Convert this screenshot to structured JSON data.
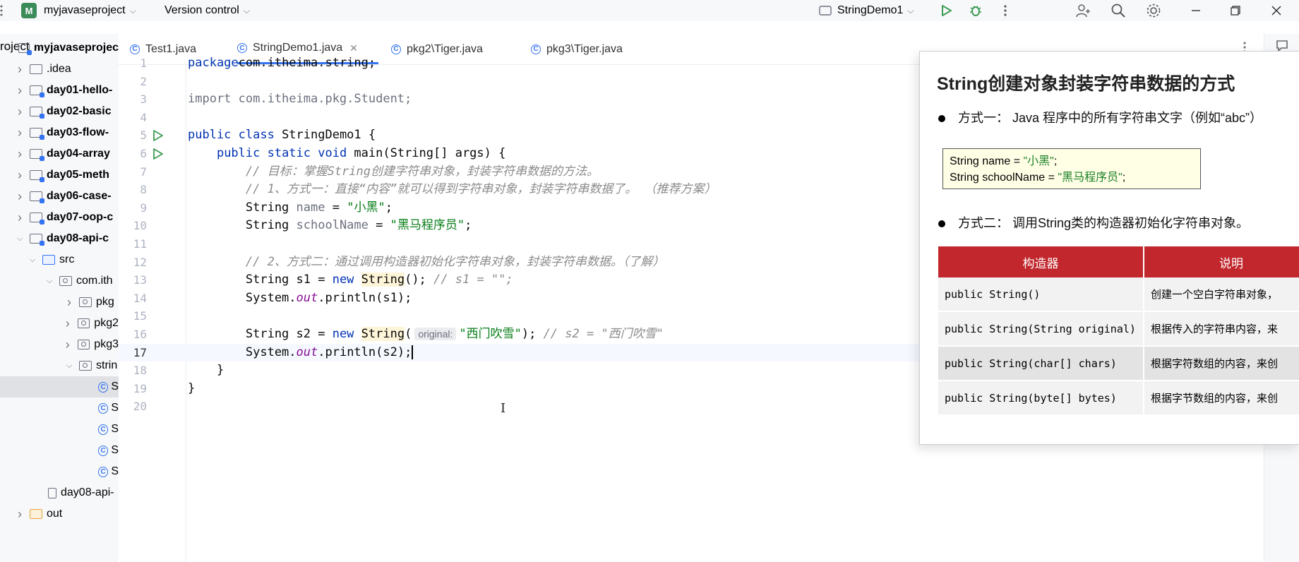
{
  "titlebar": {
    "project_badge": "M",
    "project_name": "myjavaseproject",
    "vcs": "Version control",
    "run_config": "StringDemo1",
    "icons": [
      "run-icon",
      "debug-icon",
      "more-icon",
      "add-user-icon",
      "search-icon",
      "settings-icon",
      "minimize-icon",
      "restore-icon",
      "close-icon"
    ]
  },
  "sidebar": {
    "header": "roject",
    "items": [
      {
        "label": "myjavaseprojec",
        "kind": "module",
        "arrow": "down"
      },
      {
        "label": ".idea",
        "kind": "folder",
        "arrow": "right"
      },
      {
        "label": "day01-hello-",
        "kind": "module",
        "arrow": "right"
      },
      {
        "label": "day02-basic",
        "kind": "module",
        "arrow": "right"
      },
      {
        "label": "day03-flow-",
        "kind": "module",
        "arrow": "right"
      },
      {
        "label": "day04-array",
        "kind": "module",
        "arrow": "right"
      },
      {
        "label": "day05-meth",
        "kind": "module",
        "arrow": "right"
      },
      {
        "label": "day06-case-",
        "kind": "module",
        "arrow": "right"
      },
      {
        "label": "day07-oop-c",
        "kind": "module",
        "arrow": "right"
      },
      {
        "label": "day08-api-c",
        "kind": "module",
        "arrow": "down"
      },
      {
        "label": "src",
        "kind": "src",
        "arrow": "down"
      },
      {
        "label": "com.ith",
        "kind": "package",
        "arrow": "down"
      },
      {
        "label": "pkg",
        "kind": "package",
        "arrow": "right"
      },
      {
        "label": "pkg2",
        "kind": "package",
        "arrow": "right"
      },
      {
        "label": "pkg3",
        "kind": "package",
        "arrow": "right"
      },
      {
        "label": "strin",
        "kind": "package",
        "arrow": "down"
      },
      {
        "label": "S",
        "kind": "class",
        "arrow": ""
      },
      {
        "label": "S",
        "kind": "class",
        "arrow": ""
      },
      {
        "label": "S",
        "kind": "class",
        "arrow": ""
      },
      {
        "label": "S",
        "kind": "class",
        "arrow": ""
      },
      {
        "label": "S",
        "kind": "class",
        "arrow": ""
      },
      {
        "label": "day08-api-",
        "kind": "file",
        "arrow": ""
      },
      {
        "label": "out",
        "kind": "out",
        "arrow": "right"
      }
    ]
  },
  "tabs": [
    {
      "label": "Test1.java",
      "active": false
    },
    {
      "label": "StringDemo1.java",
      "active": true
    },
    {
      "label": "pkg2\\Tiger.java",
      "active": false
    },
    {
      "label": "pkg3\\Tiger.java",
      "active": false
    }
  ],
  "editor": {
    "current_line": 17,
    "lines": [
      {
        "n": "1",
        "tokens": [
          [
            "kw",
            "package"
          ],
          [
            "",
            "com.itheima.string;"
          ]
        ]
      },
      {
        "n": "2",
        "tokens": []
      },
      {
        "n": "3",
        "tokens": [
          [
            "var",
            "import com.itheima.pkg.Student;"
          ]
        ]
      },
      {
        "n": "4",
        "tokens": []
      },
      {
        "n": "5",
        "run": true,
        "tokens": [
          [
            "kw",
            "public class "
          ],
          [
            "",
            "StringDemo1 {"
          ]
        ]
      },
      {
        "n": "6",
        "run": true,
        "tokens": [
          [
            "",
            "    "
          ],
          [
            "kw",
            "public static void "
          ],
          [
            "",
            "main(String[] args) {"
          ]
        ]
      },
      {
        "n": "7",
        "tokens": [
          [
            "cmt",
            "        // 目标：掌握String创建字符串对象，封装字符串数据的方法。"
          ]
        ]
      },
      {
        "n": "8",
        "tokens": [
          [
            "cmt",
            "        // 1、方式一：直接“内容”就可以得到字符串对象，封装字符串数据了。 （推荐方案）"
          ]
        ]
      },
      {
        "n": "9",
        "tokens": [
          [
            "",
            "        String "
          ],
          [
            "var",
            "name"
          ],
          [
            "",
            " = "
          ],
          [
            "str",
            "\"小黑\""
          ],
          [
            "",
            ";"
          ]
        ]
      },
      {
        "n": "10",
        "tokens": [
          [
            "",
            "        String "
          ],
          [
            "var",
            "schoolName"
          ],
          [
            "",
            " = "
          ],
          [
            "str",
            "\"黑马程序员\""
          ],
          [
            "",
            ";"
          ]
        ]
      },
      {
        "n": "11",
        "tokens": []
      },
      {
        "n": "12",
        "tokens": [
          [
            "cmt",
            "        // 2、方式二：通过调用构造器初始化字符串对象，封装字符串数据。（了解）"
          ]
        ]
      },
      {
        "n": "13",
        "tokens": [
          [
            "",
            "        String s1 = "
          ],
          [
            "kw",
            "new "
          ],
          [
            "hl",
            "String"
          ],
          [
            "",
            "(); "
          ],
          [
            "cmt",
            "// s1 = \"\";"
          ]
        ]
      },
      {
        "n": "14",
        "tokens": [
          [
            "",
            "        System."
          ],
          [
            "fld",
            "out"
          ],
          [
            "",
            ".println(s1);"
          ]
        ]
      },
      {
        "n": "15",
        "tokens": []
      },
      {
        "n": "16",
        "tokens": [
          [
            "",
            "        String s2 = "
          ],
          [
            "kw",
            "new "
          ],
          [
            "hl",
            "String"
          ],
          [
            "",
            "("
          ],
          [
            "hint",
            "original:"
          ],
          [
            "str",
            "\"西门吹雪\""
          ],
          [
            "",
            "); "
          ],
          [
            "cmt",
            "// s2 = \"西门吹雪\""
          ]
        ]
      },
      {
        "n": "17",
        "tokens": [
          [
            "",
            "        System."
          ],
          [
            "fld",
            "out"
          ],
          [
            "",
            ".println(s2);"
          ],
          [
            "caret",
            ""
          ]
        ]
      },
      {
        "n": "18",
        "tokens": [
          [
            "",
            "    }"
          ]
        ]
      },
      {
        "n": "19",
        "tokens": [
          [
            "",
            "}"
          ]
        ]
      },
      {
        "n": "20",
        "tokens": []
      }
    ]
  },
  "overlay": {
    "title": "String创建对象封装字符串数据的方式",
    "bullet1": "方式一：  Java 程序中的所有字符串文字（例如“abc”）",
    "code_line1_a": "String name = ",
    "code_line1_b": "\"小黑\"",
    "code_line1_c": ";",
    "code_line2_a": "String schoolName = ",
    "code_line2_b": "\"黑马程序员\"",
    "code_line2_c": ";",
    "bullet2": "方式二：  调用String类的构造器初始化字符串对象。",
    "table_headers": [
      "构造器",
      "说明"
    ],
    "table_rows": [
      [
        "public String()",
        "创建一个空白字符串对象，"
      ],
      [
        "public String(String original)",
        "根据传入的字符串内容，来"
      ],
      [
        "public String(char[] chars)",
        "根据字符数组的内容，来创"
      ],
      [
        "public String(byte[] bytes)",
        "根据字节数组的内容，来创"
      ]
    ]
  }
}
